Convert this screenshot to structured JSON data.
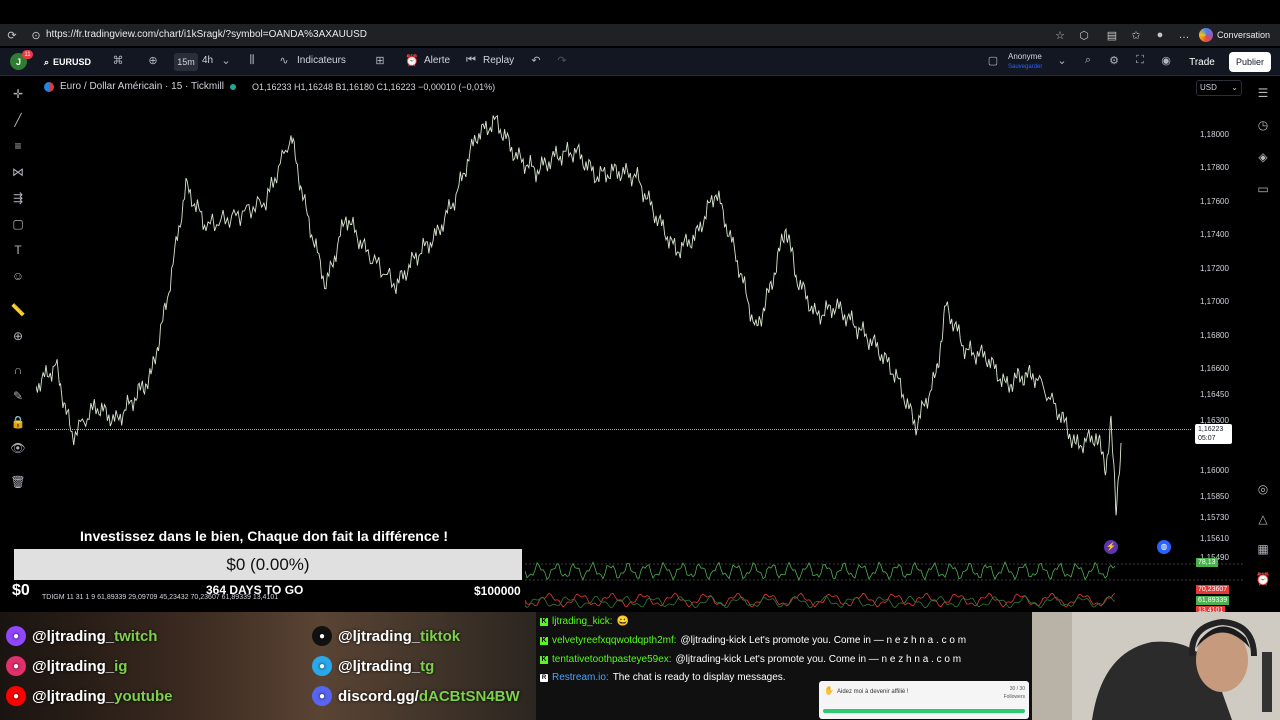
{
  "browser": {
    "url": "https://fr.tradingview.com/chart/i1kSragk/?symbol=OANDA%3AXAUUSD",
    "conversation_label": "Conversation"
  },
  "toolbar": {
    "avatar_letter": "J",
    "notif_count": "11",
    "symbol": "EURUSD",
    "tf_active": "15m",
    "tf_other": "4h",
    "indicators_label": "Indicateurs",
    "alert_label": "Alerte",
    "replay_label": "Replay",
    "account_name": "Anonyme",
    "account_save": "Sauvegarder",
    "trade_label": "Trade",
    "publish_label": "Publier"
  },
  "legend": {
    "symbol_title": "Euro / Dollar Américain · 15 · Tickmill",
    "ohlc": "O1,16233 H1,16248 B1,16180 C1,16223 −0,00010 (−0,01%)"
  },
  "price_axis": {
    "currency": "USD",
    "ticks": [
      "1,18000",
      "1,17800",
      "1,17600",
      "1,17400",
      "1,17200",
      "1,17000",
      "1,16800",
      "1,16600",
      "1,16450",
      "1,16300",
      "1,16000",
      "1,15850",
      "1,15730",
      "1,15610",
      "1,15490"
    ],
    "current_price": "1,16223",
    "countdown": "05:07"
  },
  "indicators": {
    "label": "TDIGM 11 31 1 9  61,89339  29,09709  45,23432  70,23607  61,89339  13,4101",
    "tag_green": "78,13",
    "tag_red_1": "70,23607",
    "tag_red_2": "61,89339",
    "tag_red_3": "13,4101"
  },
  "donation": {
    "title": "Investissez dans le bien, Chaque don fait la différence !",
    "progress_text": "$0 (0.00%)",
    "raised": "$0",
    "days_left": "364 DAYS TO GO",
    "goal": "$100000"
  },
  "social": [
    {
      "icon": "twitch-icon",
      "prefix": "@ljtrading_",
      "suffix": "twitch",
      "color": "#9146ff"
    },
    {
      "icon": "instagram-icon",
      "prefix": "@ljtrading_",
      "suffix": "ig",
      "color": "#e1306c"
    },
    {
      "icon": "youtube-icon",
      "prefix": "@ljtrading_",
      "suffix": "youtube",
      "color": "#ff0000"
    },
    {
      "icon": "tiktok-icon",
      "prefix": "@ljtrading_",
      "suffix": "tiktok",
      "color": "#111111"
    },
    {
      "icon": "telegram-icon",
      "prefix": "@ljtrading_",
      "suffix": "tg",
      "color": "#29a9eb"
    },
    {
      "icon": "discord-icon",
      "prefix": "discord.gg/",
      "suffix": "dACBtSN4BW",
      "color": "#5865f2"
    }
  ],
  "chat": [
    {
      "platform": "kick",
      "user": "ljtrading_kick:",
      "message": "😀"
    },
    {
      "platform": "kick",
      "user": "velvetyreefxqqwotdqpth2mf:",
      "message": "@ljtrading-kick Let's promote you. Come in — n e z h n a . c o m"
    },
    {
      "platform": "kick",
      "user": "tentativetoothpasteye59ex:",
      "message": "@ljtrading-kick Let's promote you. Come in — n e z h n a . c o m"
    },
    {
      "platform": "restream",
      "user": "Restream.io:",
      "message": "The chat is ready to display messages."
    }
  ],
  "affiliate": {
    "text": "Aidez moi à devenir affilié !",
    "count": "30 / 30",
    "count_label": "Followers",
    "progress": 1.0
  },
  "colors": {
    "price_line": "#d8e6d0",
    "indicator_green": "#4caf50",
    "indicator_red": "#e53935",
    "accent_blue": "#2962ff"
  }
}
